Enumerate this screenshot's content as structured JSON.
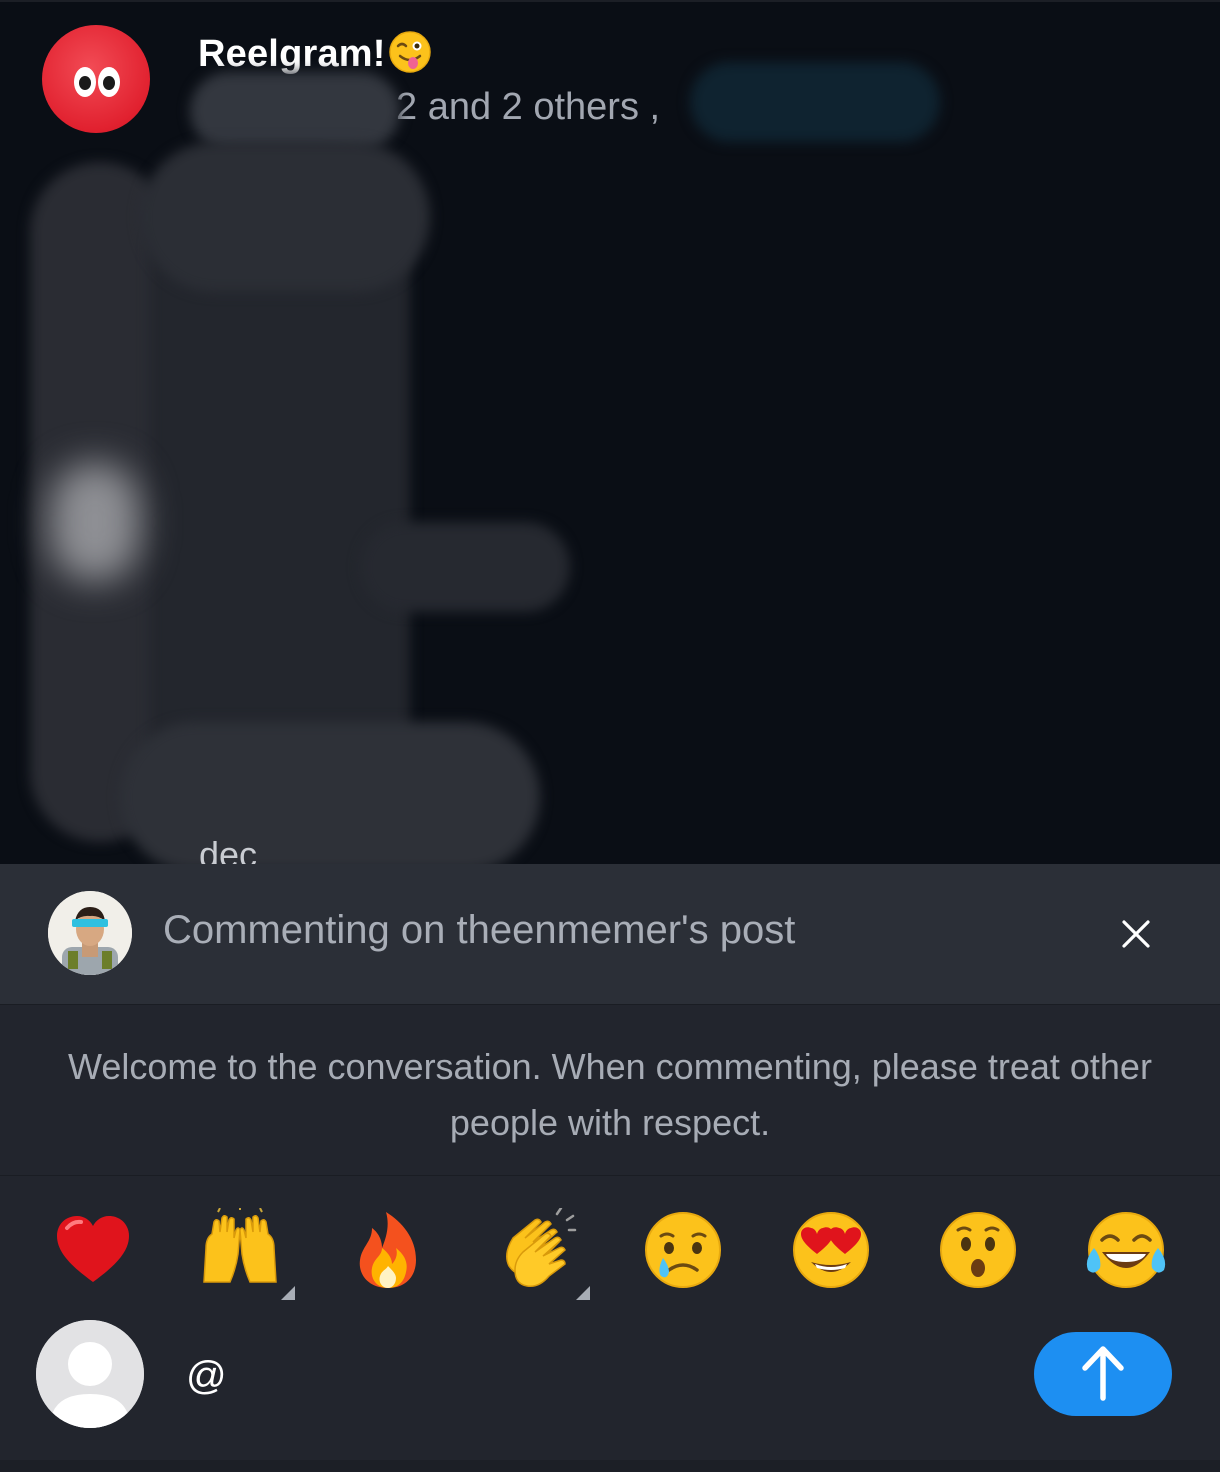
{
  "feed": {
    "group_title": "Reelgram!",
    "group_title_emoji": "winking-face-with-tongue",
    "group_subtitle": "2 and 2 others ,",
    "partial_text": "dec"
  },
  "banner": {
    "text": "Commenting on theenmemer's post",
    "close_icon": "close-icon"
  },
  "notice": {
    "text": "Welcome to the conversation. When commenting, please treat other people with respect."
  },
  "reactions": [
    {
      "name": "red-heart",
      "has_variants": false
    },
    {
      "name": "raising-hands",
      "has_variants": true
    },
    {
      "name": "fire",
      "has_variants": false
    },
    {
      "name": "clapping-hands",
      "has_variants": true
    },
    {
      "name": "crying-face",
      "has_variants": false
    },
    {
      "name": "heart-eyes-face",
      "has_variants": false
    },
    {
      "name": "surprised-face",
      "has_variants": false
    },
    {
      "name": "tears-of-joy-face",
      "has_variants": false
    }
  ],
  "composer": {
    "input_value": "@",
    "send_icon": "arrow-up-icon"
  },
  "colors": {
    "accent": "#1d8ff2",
    "banner_bg": "#2b2f37",
    "panel_bg": "#22252d",
    "feed_bg": "#0a0e15"
  }
}
